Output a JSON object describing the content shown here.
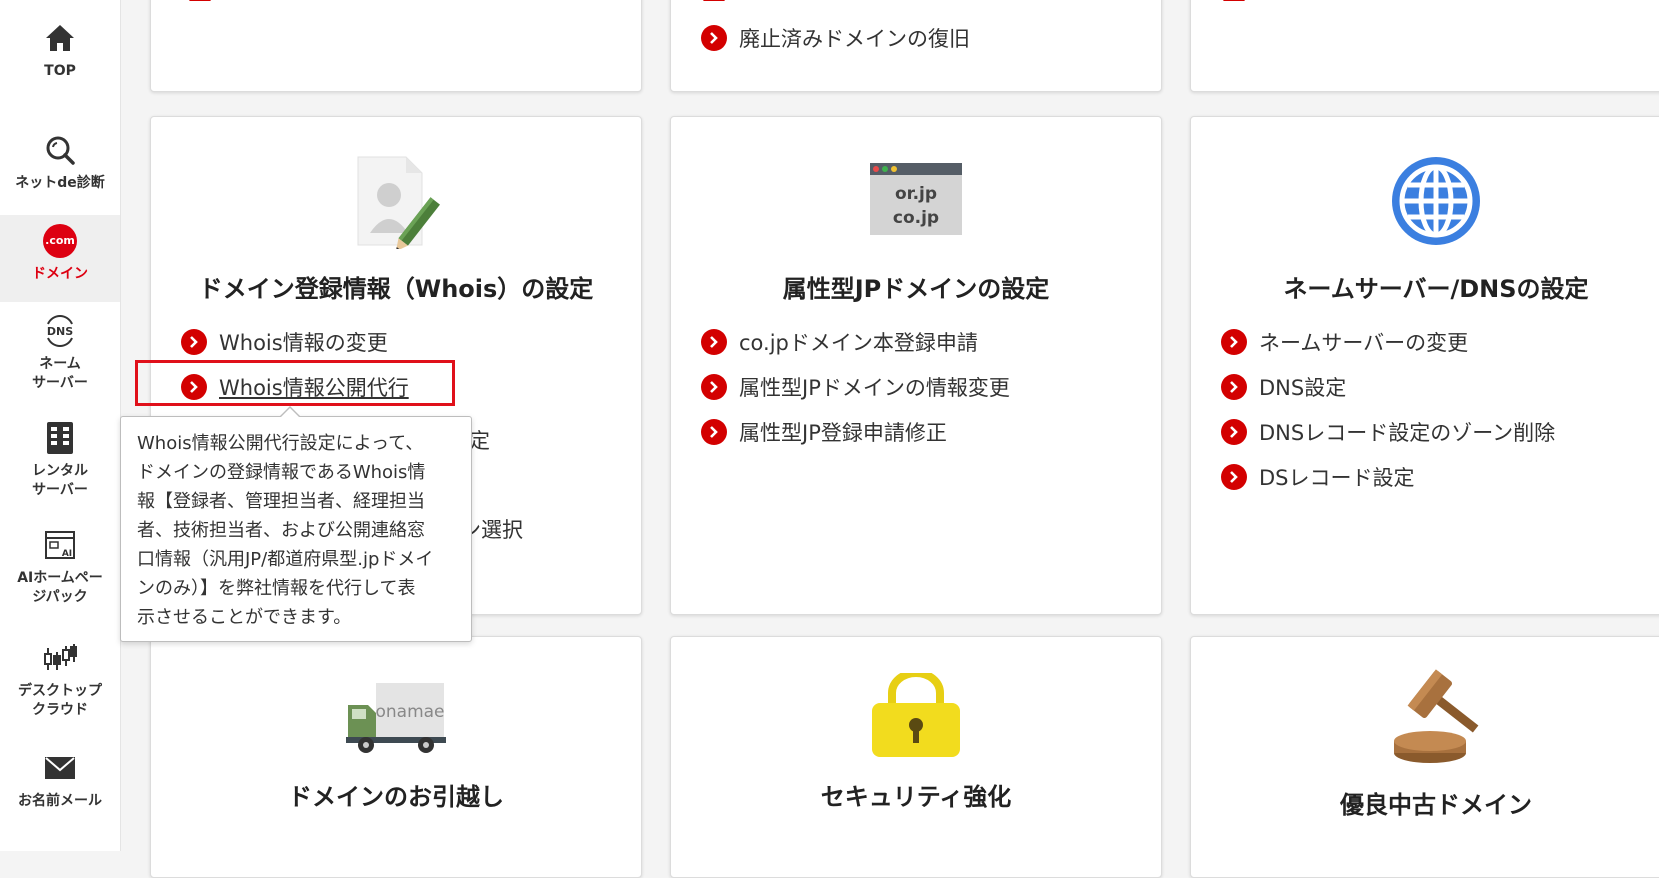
{
  "sidebar": {
    "items": [
      {
        "label": "TOP",
        "icon": "home-icon"
      },
      {
        "label": "ネットde診断",
        "icon": "search-icon"
      },
      {
        "label": "ドメイン",
        "icon": "dotcom-icon",
        "icon_text": ".com",
        "active": true
      },
      {
        "label": "ネーム\nサーバー",
        "icon": "dns-icon",
        "icon_text": "DNS"
      },
      {
        "label": "レンタル\nサーバー",
        "icon": "server-icon"
      },
      {
        "label": "AIホームペー\nジパック",
        "icon": "ai-homepage-icon",
        "icon_text": "AI"
      },
      {
        "label": "デスクトップ\nクラウド",
        "icon": "chart-candle-icon"
      },
      {
        "label": "お名前メール",
        "icon": "mail-icon"
      }
    ]
  },
  "top_cards": {
    "middle_link": "廃止済みドメインの復旧"
  },
  "cards": {
    "whois": {
      "title": "ドメイン登録情報（Whois）の設定",
      "icon": "document-pencil-icon",
      "links": [
        "Whois情報の変更",
        "Whois情報公開代行"
      ],
      "hidden_fragments": [
        "定",
        "ン選択"
      ]
    },
    "jp": {
      "title": "属性型JPドメインの設定",
      "icon": "browser-window-icon",
      "icon_lines": [
        "or.jp",
        "co.jp"
      ],
      "links": [
        "co.jpドメイン本登録申請",
        "属性型JPドメインの情報変更",
        "属性型JP登録申請修正"
      ]
    },
    "dns": {
      "title": "ネームサーバー/DNSの設定",
      "icon": "globe-icon",
      "links": [
        "ネームサーバーの変更",
        "DNS設定",
        "DNSレコード設定のゾーン削除",
        "DSレコード設定"
      ]
    },
    "move": {
      "title": "ドメインのお引越し",
      "icon": "truck-icon",
      "icon_text": "onamae"
    },
    "security": {
      "title": "セキュリティ強化",
      "icon": "padlock-icon"
    },
    "used": {
      "title": "優良中古ドメイン",
      "icon": "gavel-icon"
    }
  },
  "tooltip": {
    "lines": [
      "Whois情報公開代行設定によって、",
      "ドメインの登録情報であるWhois情",
      "報【登録者、管理担当者、経理担当",
      "者、技術担当者、および公開連絡窓",
      "口情報（汎用JP/都道府県型.jpドメイ",
      "ンのみ）】を弊社情報を代行して表",
      "示させることができます。"
    ]
  },
  "colors": {
    "accent": "#d30000",
    "active_nav": "#dd0011",
    "highlight": "#e0101a",
    "globe": "#3b7fe0",
    "padlock": "#f2dc1e"
  }
}
